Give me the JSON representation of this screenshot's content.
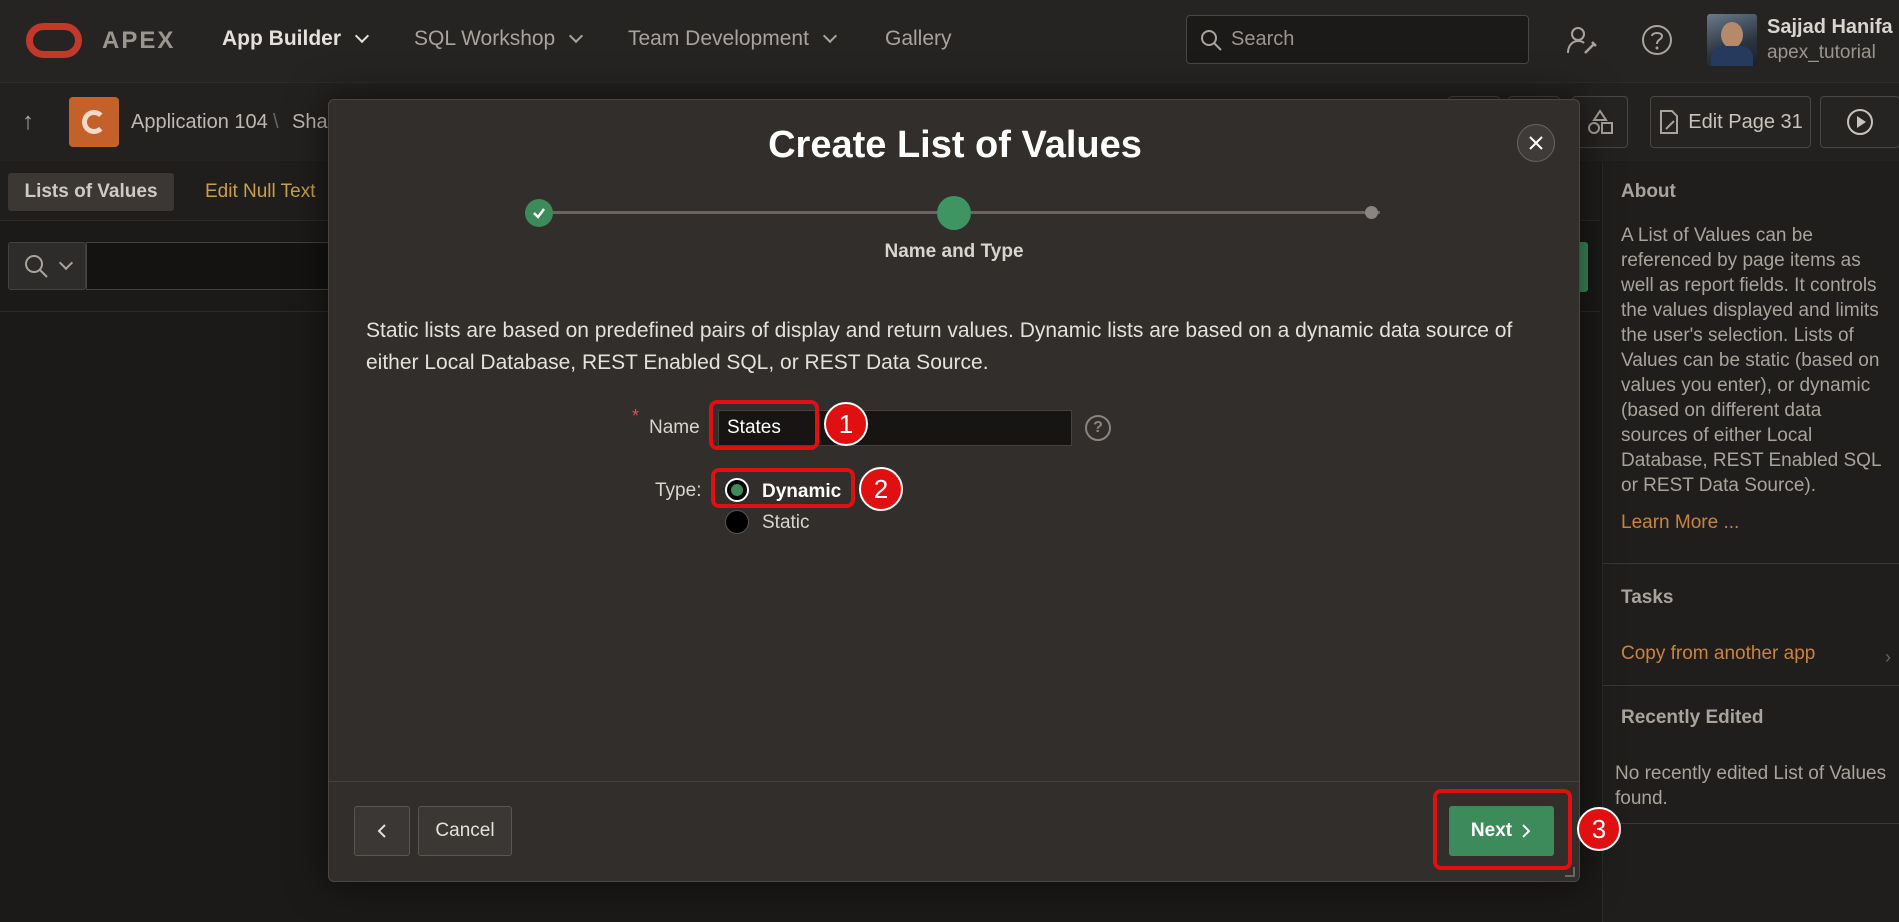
{
  "header": {
    "brand": "APEX",
    "nav": [
      {
        "label": "App Builder"
      },
      {
        "label": "SQL Workshop"
      },
      {
        "label": "Team Development"
      },
      {
        "label": "Gallery"
      }
    ],
    "search_placeholder": "Search",
    "user": {
      "name": "Sajjad Hanifa",
      "workspace": "apex_tutorial"
    }
  },
  "toolbar": {
    "breadcrumb_app": "Application 104",
    "breadcrumb_sep": "\\",
    "breadcrumb_partial": "Shar",
    "edit_page_label": "Edit Page 31"
  },
  "page": {
    "tab_active": "Lists of Values",
    "tab_link": "Edit Null Text"
  },
  "side_panel": {
    "about_title": "About",
    "about_text": "A List of Values can be referenced by page items as well as report fields. It controls the values displayed and limits the user's selection. Lists of Values can be static (based on values you enter), or dynamic (based on different data sources of either Local Database, REST Enabled SQL or REST Data Source).",
    "learn_more": "Learn More ...",
    "tasks_title": "Tasks",
    "task_copy": "Copy from another app",
    "recent_title": "Recently Edited",
    "recent_text": "No recently edited List of Values found."
  },
  "dialog": {
    "title": "Create List of Values",
    "step_label": "Name and Type",
    "intro": "Static lists are based on predefined pairs of display and return values. Dynamic lists are based on a dynamic data source of either Local Database, REST Enabled SQL, or REST Data Source.",
    "required_mark": "*",
    "name_label": "Name",
    "name_value": "States",
    "help_glyph": "?",
    "type_label": "Type:",
    "type_options": [
      {
        "label": "Dynamic",
        "selected": true
      },
      {
        "label": "Static",
        "selected": false
      }
    ],
    "cancel_label": "Cancel",
    "next_label": "Next"
  },
  "annotations": [
    "1",
    "2",
    "3"
  ],
  "colors": {
    "accent_green": "#3d8a5a",
    "annotation_red": "#e01010",
    "link_gold": "#c9a04a"
  }
}
